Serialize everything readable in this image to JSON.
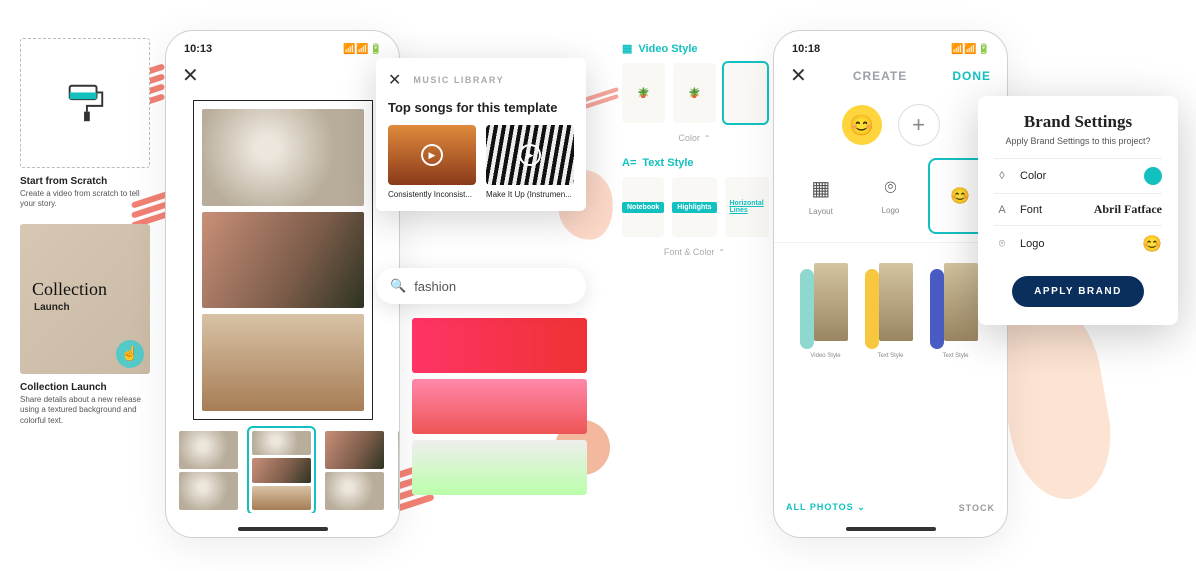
{
  "templates": {
    "scratch": {
      "title": "Start from Scratch",
      "desc": "Create a video from scratch to tell your story."
    },
    "collection": {
      "title": "Collection Launch",
      "desc": "Share details about a new release using a textured background and colorful text.",
      "card_heading": "Collection",
      "card_sub": "Launch"
    }
  },
  "phone1": {
    "time": "10:13"
  },
  "music": {
    "close": "✕",
    "section": "MUSIC LIBRARY",
    "heading": "Top songs for this template",
    "songs": [
      {
        "name": "Consistently Inconsist..."
      },
      {
        "name": "Make It Up (Instrumen..."
      }
    ]
  },
  "search": {
    "placeholder": "fashion"
  },
  "style_panel": {
    "video": "Video Style",
    "color": "Color",
    "text": "Text Style",
    "fontcolor": "Font & Color",
    "tags": [
      "Notebook",
      "Highlights",
      "Horizontal Lines"
    ]
  },
  "phone2": {
    "time": "10:18",
    "create": "CREATE",
    "done": "DONE",
    "opts": [
      {
        "label": "Layout"
      },
      {
        "label": "Logo"
      },
      {
        "label": ""
      }
    ],
    "filter_all": "ALL PHOTOS",
    "filter_stock": "STOCK"
  },
  "brand": {
    "title": "Brand Settings",
    "sub": "Apply Brand Settings to this project?",
    "rows": {
      "color": "Color",
      "font": "Font",
      "font_val": "Abril Fatface",
      "logo": "Logo"
    },
    "apply": "APPLY BRAND"
  }
}
